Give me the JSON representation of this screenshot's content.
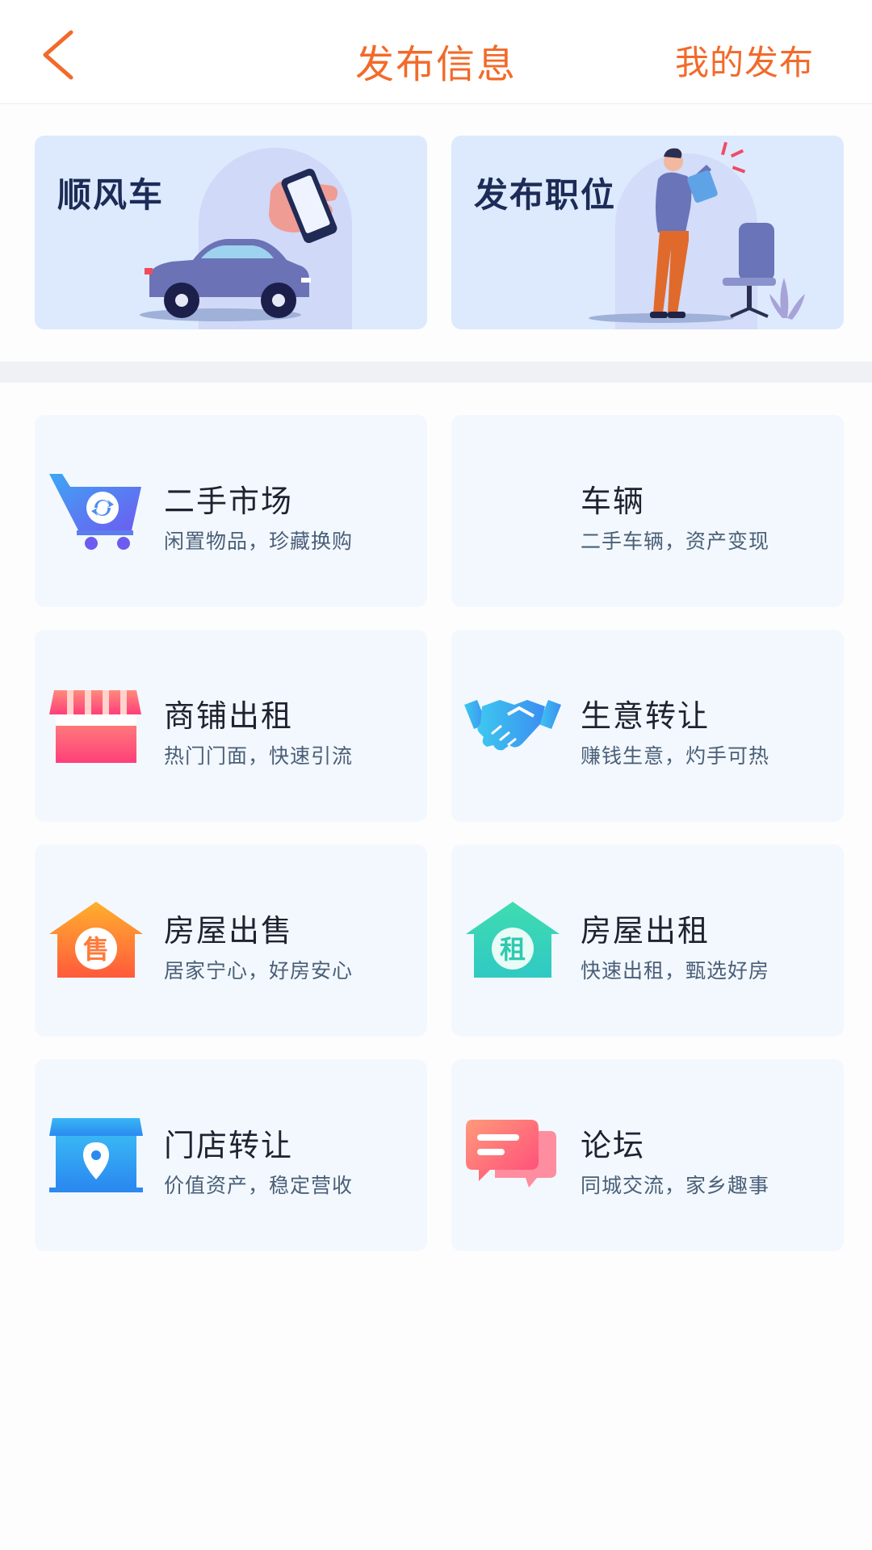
{
  "header": {
    "back_icon": "chevron-left-icon",
    "title": "发布信息",
    "my_posts_label": "我的发布",
    "accent_color": "#f26a2a"
  },
  "banners": [
    {
      "label": "顺风车",
      "illustration": "car-and-phone-illustration"
    },
    {
      "label": "发布职位",
      "illustration": "man-with-megaphone-and-chair-illustration"
    }
  ],
  "categories": [
    {
      "title": "二手市场",
      "subtitle": "闲置物品，珍藏换购",
      "icon": "shopping-cart-icon"
    },
    {
      "title": "车辆",
      "subtitle": "二手车辆，资产变现",
      "icon": ""
    },
    {
      "title": "商铺出租",
      "subtitle": "热门门面，快速引流",
      "icon": "storefront-icon"
    },
    {
      "title": "生意转让",
      "subtitle": "赚钱生意，灼手可热",
      "icon": "handshake-icon"
    },
    {
      "title": "房屋出售",
      "subtitle": "居家宁心，好房安心",
      "icon": "house-sale-icon",
      "icon_char": "售"
    },
    {
      "title": "房屋出租",
      "subtitle": "快速出租，甄选好房",
      "icon": "house-rent-icon",
      "icon_char": "租"
    },
    {
      "title": "门店转让",
      "subtitle": "价值资产，稳定营收",
      "icon": "shop-location-icon"
    },
    {
      "title": "论坛",
      "subtitle": "同城交流，家乡趣事",
      "icon": "chat-bubbles-icon"
    }
  ]
}
